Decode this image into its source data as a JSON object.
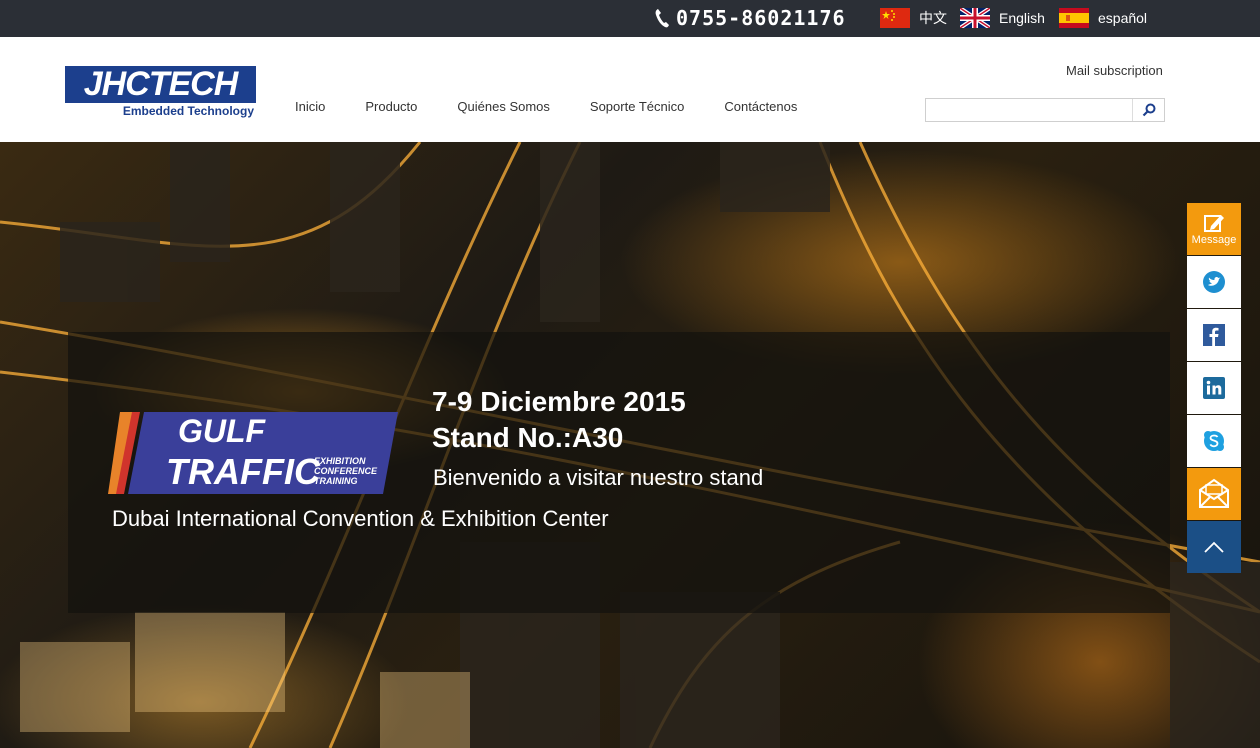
{
  "topbar": {
    "phone": "0755-86021176",
    "languages": [
      {
        "label": "中文",
        "flag": "china-flag-icon"
      },
      {
        "label": "English",
        "flag": "uk-flag-icon"
      },
      {
        "label": "español",
        "flag": "spain-flag-icon"
      }
    ]
  },
  "header": {
    "logo_text": "JHCTECH",
    "logo_tagline": "Embedded Technology",
    "nav": [
      "Inicio",
      "Producto",
      "Quiénes Somos",
      "Soporte Técnico",
      "Contáctenos"
    ],
    "mail_subscription": "Mail subscription",
    "search_placeholder": ""
  },
  "banner": {
    "event_logo_line1": "GULF",
    "event_logo_line2": "TRAFFIC",
    "event_logo_tags": [
      "EXHIBITION",
      "CONFERENCE",
      "TRAINING"
    ],
    "date": "7-9 Diciembre 2015",
    "stand": "Stand No.:A30",
    "welcome": "Bienvenido a visitar nuestro stand",
    "venue": "Dubai International Convention & Exhibition Center"
  },
  "side_toolbar": {
    "message_label": "Message",
    "items": [
      "message-icon",
      "twitter-icon",
      "facebook-icon",
      "linkedin-icon",
      "skype-icon",
      "mail-icon",
      "back-to-top-icon"
    ]
  },
  "colors": {
    "topbar_bg": "#2b2f36",
    "brand_blue": "#1c3f8d",
    "accent_orange": "#f39a0e",
    "top_button_blue": "#1b4f86"
  }
}
